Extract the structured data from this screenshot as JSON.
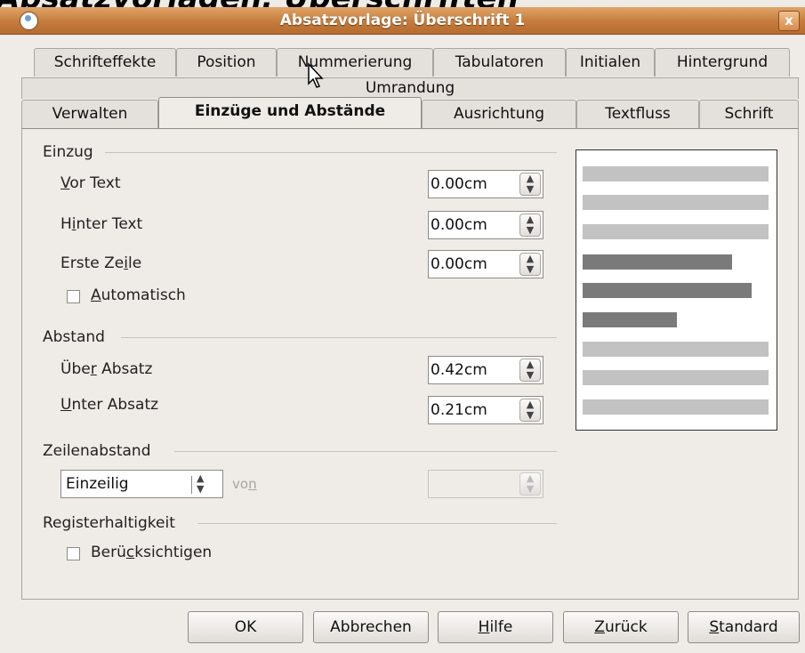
{
  "background_heading": "Absatzvorlagen: Überschriften",
  "window": {
    "title": "Absatzvorlage: Überschrift 1",
    "close_label": "x"
  },
  "tabs": {
    "row1": [
      "Schrifteffekte",
      "Position",
      "Nummerierung",
      "Tabulatoren",
      "Initialen",
      "Hintergrund"
    ],
    "row2": [
      "Umrandung"
    ],
    "row3": [
      "Verwalten",
      "Einzüge und Abstände",
      "Ausrichtung",
      "Textfluss",
      "Schrift"
    ],
    "active": "Einzüge und Abstände"
  },
  "indent": {
    "section_label": "Einzug",
    "before_text": {
      "label_pre": "",
      "label_key": "V",
      "label_post": "or Text",
      "value": "0.00cm"
    },
    "after_text": {
      "label_pre": "H",
      "label_key": "i",
      "label_post": "nter Text",
      "value": "0.00cm"
    },
    "first_line": {
      "label_pre": "Erste Ze",
      "label_key": "i",
      "label_post": "le",
      "value": "0.00cm"
    },
    "automatic": {
      "label_pre": "",
      "label_key": "A",
      "label_post": "utomatisch",
      "checked": false
    }
  },
  "spacing": {
    "section_label": "Abstand",
    "above": {
      "label_pre": "Übe",
      "label_key": "r",
      "label_post": " Absatz",
      "value": "0.42cm"
    },
    "below": {
      "label_pre": "",
      "label_key": "U",
      "label_post": "nter Absatz",
      "value": "0.21cm"
    }
  },
  "line_spacing": {
    "section_label": "Zeilenabstand",
    "mode": "Einzeilig",
    "of_label_pre": "vo",
    "of_label_key": "n",
    "of_value": ""
  },
  "register": {
    "section_label": "Registerhaltigkeit",
    "consider": {
      "label_pre": "Berü",
      "label_key": "c",
      "label_post": "ksichtigen",
      "checked": false
    }
  },
  "buttons": {
    "ok": "OK",
    "cancel": "Abbrechen",
    "help_pre": "",
    "help_key": "H",
    "help_post": "ilfe",
    "back_pre": "",
    "back_key": "Z",
    "back_post": "urück",
    "standard_pre": "",
    "standard_key": "S",
    "standard_post": "tandard"
  },
  "colors": {
    "titlebar": "#c47b3b",
    "dialog_bg": "#efebe7",
    "preview_light": "#c2c2c2",
    "preview_dark": "#7a7a7a"
  }
}
